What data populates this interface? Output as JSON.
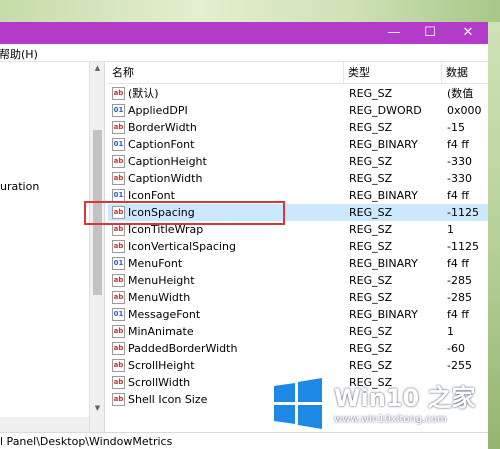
{
  "titlebar": {
    "minimize_glyph": "—",
    "maximize_glyph": "☐",
    "close_glyph": "✕"
  },
  "menubar": {
    "help_label": "帮助(H)"
  },
  "tree": {
    "partial_text": "uration"
  },
  "list": {
    "columns": [
      "名称",
      "类型",
      "数据"
    ],
    "rows": [
      {
        "name": "(默认)",
        "type": "REG_SZ",
        "data": "(数值",
        "icon": "ab"
      },
      {
        "name": "AppliedDPI",
        "type": "REG_DWORD",
        "data": "0x000",
        "icon": "bin"
      },
      {
        "name": "BorderWidth",
        "type": "REG_SZ",
        "data": "-15",
        "icon": "ab"
      },
      {
        "name": "CaptionFont",
        "type": "REG_BINARY",
        "data": "f4 ff",
        "icon": "bin"
      },
      {
        "name": "CaptionHeight",
        "type": "REG_SZ",
        "data": "-330",
        "icon": "ab"
      },
      {
        "name": "CaptionWidth",
        "type": "REG_SZ",
        "data": "-330",
        "icon": "ab"
      },
      {
        "name": "IconFont",
        "type": "REG_BINARY",
        "data": "f4 ff",
        "icon": "bin"
      },
      {
        "name": "IconSpacing",
        "type": "REG_SZ",
        "data": "-1125",
        "icon": "ab",
        "selected": true
      },
      {
        "name": "IconTitleWrap",
        "type": "REG_SZ",
        "data": "1",
        "icon": "ab"
      },
      {
        "name": "IconVerticalSpacing",
        "type": "REG_SZ",
        "data": "-1125",
        "icon": "ab"
      },
      {
        "name": "MenuFont",
        "type": "REG_BINARY",
        "data": "f4 ff",
        "icon": "bin"
      },
      {
        "name": "MenuHeight",
        "type": "REG_SZ",
        "data": "-285",
        "icon": "ab"
      },
      {
        "name": "MenuWidth",
        "type": "REG_SZ",
        "data": "-285",
        "icon": "ab"
      },
      {
        "name": "MessageFont",
        "type": "REG_BINARY",
        "data": "f4 ff",
        "icon": "bin"
      },
      {
        "name": "MinAnimate",
        "type": "REG_SZ",
        "data": "1",
        "icon": "ab"
      },
      {
        "name": "PaddedBorderWidth",
        "type": "REG_SZ",
        "data": "-60",
        "icon": "ab"
      },
      {
        "name": "ScrollHeight",
        "type": "REG_SZ",
        "data": "-255",
        "icon": "ab"
      },
      {
        "name": "ScrollWidth",
        "type": "REG_SZ",
        "data": "",
        "icon": "ab"
      },
      {
        "name": "Shell Icon Size",
        "type": "",
        "data": "",
        "icon": "ab"
      }
    ]
  },
  "statusbar": {
    "path": "l Panel\\Desktop\\WindowMetrics"
  },
  "watermark": {
    "title": "Win10 之家",
    "url": "www.win10xitong.com"
  },
  "colors": {
    "titlebar": "#b23bc9",
    "selection": "#cce8ff",
    "highlight_border": "#d9383a",
    "logo_blue": "#1e88e5"
  }
}
